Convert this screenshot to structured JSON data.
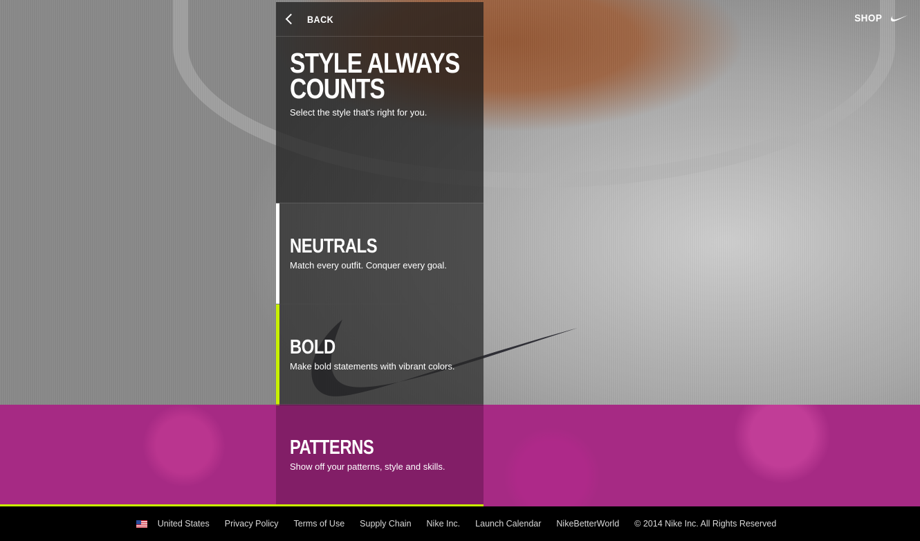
{
  "header": {
    "back_label": "BACK",
    "shop_label": "SHOP"
  },
  "hero": {
    "title_line1": "STYLE ALWAYS",
    "title_line2": "COUNTS",
    "subtitle": "Select the style that's right for you."
  },
  "options": [
    {
      "title": "NEUTRALS",
      "desc": "Match every outfit. Conquer every goal.",
      "accent": "#ffffff"
    },
    {
      "title": "BOLD",
      "desc": "Make bold statements with vibrant colors.",
      "accent": "#c8f000"
    },
    {
      "title": "PATTERNS",
      "desc": "Show off your patterns, style and skills.",
      "accent": ""
    }
  ],
  "footer": {
    "country": "United States",
    "links": [
      "Privacy Policy",
      "Terms of Use",
      "Supply Chain",
      "Nike Inc.",
      "Launch Calendar",
      "NikeBetterWorld"
    ],
    "copyright": "© 2014 Nike Inc. All Rights Reserved"
  },
  "colors": {
    "accent_volt": "#c8f000",
    "pink": "#a62a84"
  }
}
